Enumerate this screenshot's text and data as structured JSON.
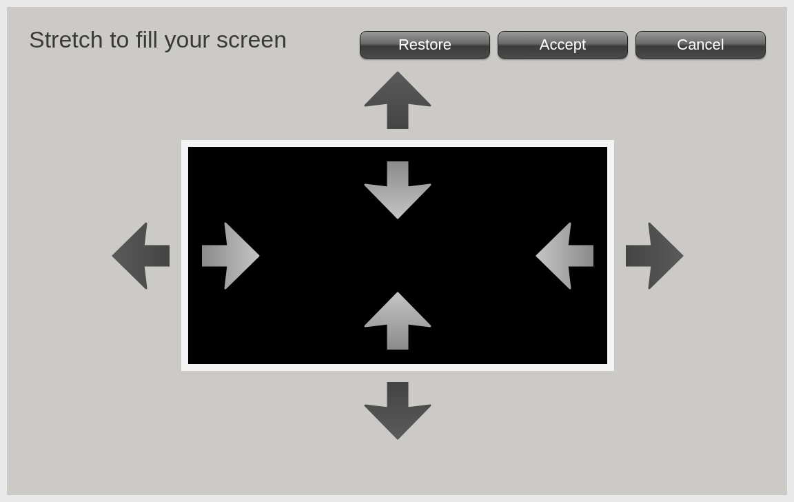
{
  "title": "Stretch to fill your screen",
  "buttons": [
    {
      "label": "Restore"
    },
    {
      "label": "Accept"
    },
    {
      "label": "Cancel"
    }
  ]
}
